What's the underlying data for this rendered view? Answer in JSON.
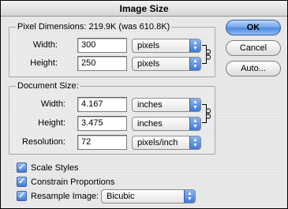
{
  "window": {
    "title": "Image Size"
  },
  "pixel_dimensions": {
    "label": "Pixel Dimensions:",
    "size_text": "219.9K (was 610.8K)",
    "width_label": "Width:",
    "width_value": "300",
    "width_unit": "pixels",
    "height_label": "Height:",
    "height_value": "250",
    "height_unit": "pixels"
  },
  "document_size": {
    "label": "Document Size:",
    "width_label": "Width:",
    "width_value": "4.167",
    "width_unit": "inches",
    "height_label": "Height:",
    "height_value": "3.475",
    "height_unit": "inches",
    "resolution_label": "Resolution:",
    "resolution_value": "72",
    "resolution_unit": "pixels/inch"
  },
  "options": {
    "scale_styles": {
      "label": "Scale Styles",
      "checked": true
    },
    "constrain_proportions": {
      "label": "Constrain Proportions",
      "checked": true
    },
    "resample_image": {
      "label": "Resample Image:",
      "checked": true,
      "method": "Bicubic"
    }
  },
  "buttons": {
    "ok": "OK",
    "cancel": "Cancel",
    "auto": "Auto..."
  },
  "icons": {
    "popup_arrows": "updown-arrows-icon",
    "link": "chain-link-icon",
    "check": "checkmark-icon"
  }
}
